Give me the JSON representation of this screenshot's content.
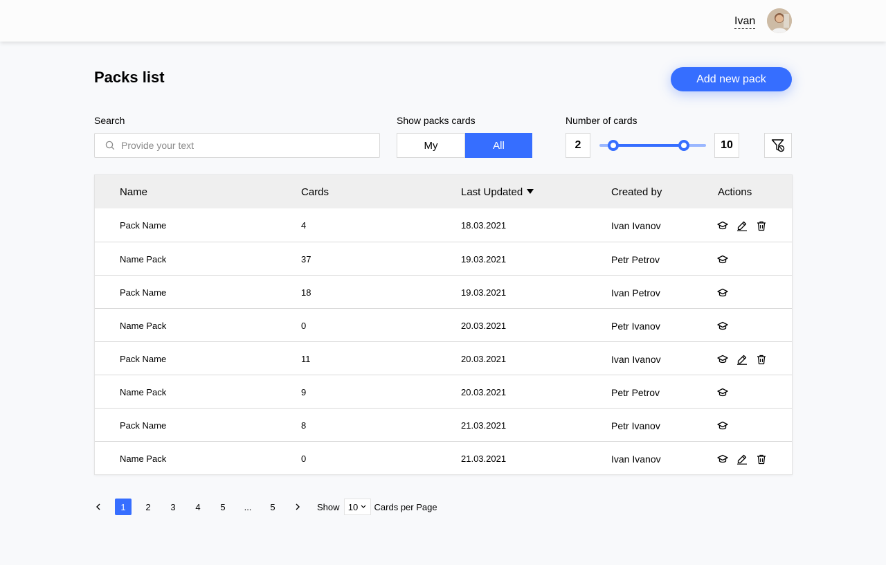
{
  "header": {
    "user_name": "Ivan"
  },
  "page": {
    "title": "Packs list",
    "add_button_label": "Add new pack"
  },
  "filters": {
    "search_label": "Search",
    "search_placeholder": "Provide your text",
    "search_value": "",
    "show_label": "Show packs cards",
    "show_options": [
      "My",
      "All"
    ],
    "show_selected": "All",
    "number_label": "Number of cards",
    "min_value": "2",
    "max_value": "10",
    "slider_low_fraction": 0.13,
    "slider_high_fraction": 0.79
  },
  "table": {
    "columns": {
      "name": "Name",
      "cards": "Cards",
      "updated": "Last Updated",
      "created_by": "Created by",
      "actions": "Actions"
    },
    "rows": [
      {
        "name": "Pack Name",
        "cards": "4",
        "updated": "18.03.2021",
        "author": "Ivan Ivanov",
        "own": true
      },
      {
        "name": "Name Pack",
        "cards": "37",
        "updated": "19.03.2021",
        "author": "Petr Petrov",
        "own": false
      },
      {
        "name": "Pack Name",
        "cards": "18",
        "updated": "19.03.2021",
        "author": "Ivan Petrov",
        "own": false
      },
      {
        "name": "Name Pack",
        "cards": "0",
        "updated": "20.03.2021",
        "author": "Petr Ivanov",
        "own": false
      },
      {
        "name": "Pack Name",
        "cards": "11",
        "updated": "20.03.2021",
        "author": "Ivan Ivanov",
        "own": true
      },
      {
        "name": "Name Pack",
        "cards": "9",
        "updated": "20.03.2021",
        "author": "Petr Petrov",
        "own": false
      },
      {
        "name": "Pack Name",
        "cards": "8",
        "updated": "21.03.2021",
        "author": "Petr Ivanov",
        "own": false
      },
      {
        "name": "Name Pack",
        "cards": "0",
        "updated": "21.03.2021",
        "author": "Ivan Ivanov",
        "own": true
      }
    ]
  },
  "pagination": {
    "pages": [
      "1",
      "2",
      "3",
      "4",
      "5",
      "...",
      "5"
    ],
    "current": "1",
    "show_label": "Show",
    "per_page": "10",
    "per_page_suffix": "Cards per Page"
  },
  "colors": {
    "accent": "#366eff",
    "accent_light": "#9ab7ff"
  },
  "icons": [
    "learn-icon",
    "edit-icon",
    "delete-icon",
    "search-icon",
    "filter-clear-icon",
    "chevron-left-icon",
    "chevron-right-icon",
    "chevron-down-icon",
    "sort-down-icon"
  ]
}
